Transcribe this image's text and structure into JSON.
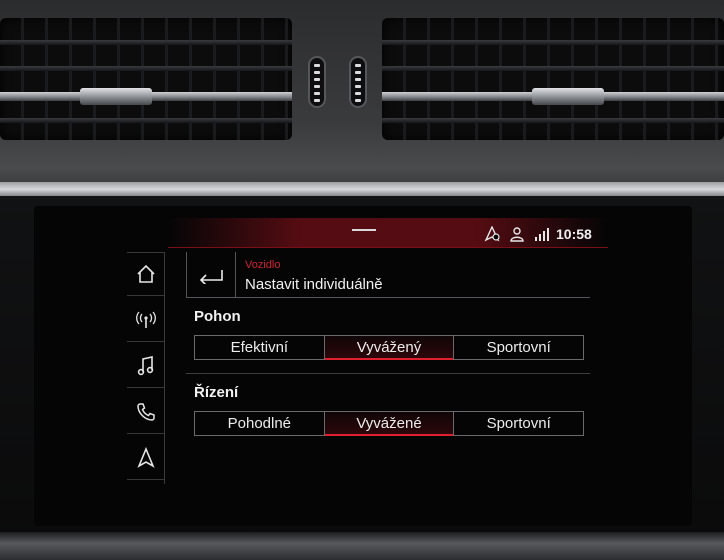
{
  "status": {
    "time": "10:58",
    "icons": [
      "navigation-sync-icon",
      "user-profile-icon",
      "signal-speed-icon"
    ]
  },
  "sidebar": {
    "items": [
      {
        "icon": "home-icon"
      },
      {
        "icon": "radio-antenna-icon"
      },
      {
        "icon": "music-note-icon"
      },
      {
        "icon": "phone-icon"
      },
      {
        "icon": "navigation-arrow-icon"
      }
    ]
  },
  "header": {
    "breadcrumb": "Vozidlo",
    "title": "Nastavit individuálně"
  },
  "sections": {
    "drive": {
      "label": "Pohon",
      "options": [
        "Efektivní",
        "Vyvážený",
        "Sportovní"
      ],
      "selected": "Vyvážený"
    },
    "steering": {
      "label": "Řízení",
      "options": [
        "Pohodlné",
        "Vyvážené",
        "Sportovní"
      ],
      "selected": "Vyvážené"
    }
  },
  "colors": {
    "accent": "#d2212f",
    "text": "#f2f2f2",
    "background": "#050506"
  }
}
